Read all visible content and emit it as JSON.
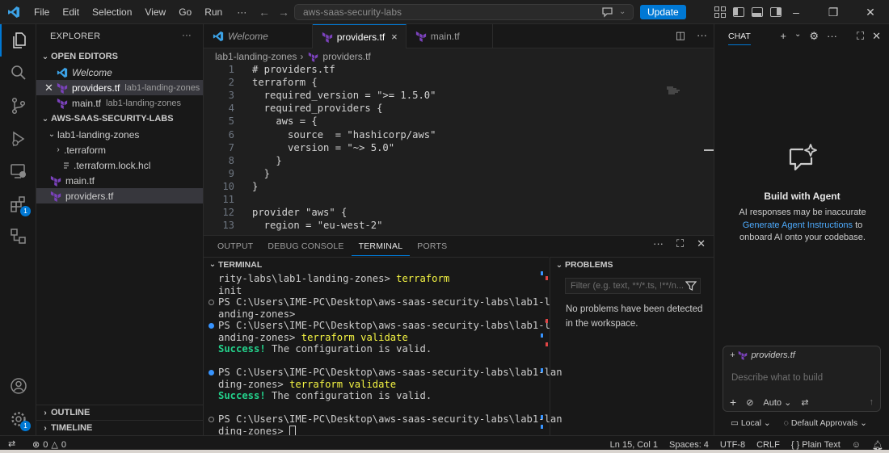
{
  "titlebar": {
    "menu": [
      "File",
      "Edit",
      "Selection",
      "View",
      "Go",
      "Run"
    ],
    "more": "···",
    "search": "aws-saas-security-labs",
    "update_label": "Update",
    "colors": {
      "accent": "#0078d4"
    }
  },
  "activitybar": {
    "extensions_badge": "1",
    "settings_badge": "1"
  },
  "explorer": {
    "title": "EXPLORER",
    "more": "···",
    "open_editors": {
      "title": "OPEN EDITORS",
      "items": [
        {
          "label": "Welcome",
          "desc": ""
        },
        {
          "label": "providers.tf",
          "desc": "lab1-landing-zones"
        },
        {
          "label": "main.tf",
          "desc": "lab1-landing-zones"
        }
      ]
    },
    "workspace": {
      "title": "AWS-SAAS-SECURITY-LABS",
      "folder": "lab1-landing-zones",
      "items": [
        ".terraform",
        ".terraform.lock.hcl",
        "main.tf",
        "providers.tf"
      ]
    },
    "outline": "OUTLINE",
    "timeline": "TIMELINE"
  },
  "editor": {
    "tabs": [
      {
        "label": "Welcome"
      },
      {
        "label": "providers.tf",
        "close": "×"
      },
      {
        "label": "main.tf"
      }
    ],
    "breadcrumb": {
      "folder": "lab1-landing-zones",
      "file": "providers.tf",
      "sep": "›"
    },
    "lines": [
      {
        "n": "1",
        "text": "# providers.tf"
      },
      {
        "n": "2",
        "text": "terraform {"
      },
      {
        "n": "3",
        "text": "  required_version = \">= 1.5.0\""
      },
      {
        "n": "4",
        "text": "  required_providers {"
      },
      {
        "n": "5",
        "text": "    aws = {"
      },
      {
        "n": "6",
        "text": "      source  = \"hashicorp/aws\""
      },
      {
        "n": "7",
        "text": "      version = \"~> 5.0\""
      },
      {
        "n": "8",
        "text": "    }"
      },
      {
        "n": "9",
        "text": "  }"
      },
      {
        "n": "10",
        "text": "}"
      },
      {
        "n": "11",
        "text": ""
      },
      {
        "n": "12",
        "text": "provider \"aws\" {"
      },
      {
        "n": "13",
        "text": "  region = \"eu-west-2\""
      }
    ]
  },
  "panel": {
    "tabs": [
      "OUTPUT",
      "DEBUG CONSOLE",
      "TERMINAL",
      "PORTS"
    ],
    "more": "···",
    "terminal": {
      "title": "TERMINAL",
      "l1a": "rity-labs\\lab1-landing-zones> ",
      "l1b": "terraform",
      "l2": "init",
      "l3": "PS C:\\Users\\IME-PC\\Desktop\\aws-saas-security-labs\\lab1-l",
      "l4": "anding-zones>",
      "l5": "PS C:\\Users\\IME-PC\\Desktop\\aws-saas-security-labs\\lab1-l",
      "l6a": "anding-zones> ",
      "l6b": "terraform validate",
      "l7a": "Success!",
      "l7b": " The configuration is valid.",
      "l8": "PS C:\\Users\\IME-PC\\Desktop\\aws-saas-security-labs\\lab1-lan",
      "l9a": "ding-zones> ",
      "l9b": "terraform validate",
      "l10a": "Success!",
      "l10b": " The configuration is valid.",
      "l11": "PS C:\\Users\\IME-PC\\Desktop\\aws-saas-security-labs\\lab1-lan",
      "l12": "ding-zones> "
    },
    "problems": {
      "title": "PROBLEMS",
      "filter_placeholder": "Filter (e.g. text, **/*.ts, !**/n...",
      "message": "No problems have been detected in the workspace."
    }
  },
  "chat": {
    "title": "CHAT",
    "heading": "Build with Agent",
    "text1": "AI responses may be inaccurate",
    "link": "Generate Agent Instructions",
    "text2": " to onboard AI onto your codebase.",
    "context_file": "providers.tf",
    "placeholder": "Describe what to build",
    "mode": "Auto",
    "local": "Local",
    "approvals": "Default Approvals"
  },
  "statusbar": {
    "errors": "0",
    "warnings": "0",
    "position": "Ln 15, Col 1",
    "spaces": "Spaces: 4",
    "encoding": "UTF-8",
    "eol": "CRLF",
    "language": "Plain Text",
    "language_prefix": "{ }"
  }
}
